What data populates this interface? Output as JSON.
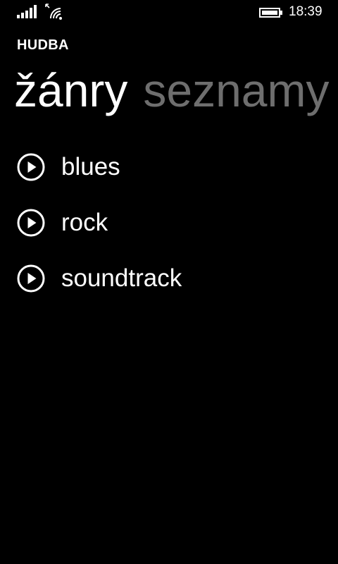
{
  "status_bar": {
    "time": "18:39",
    "icons": [
      "signal-strength-icon",
      "wifi-icon",
      "battery-icon"
    ]
  },
  "app": {
    "title": "HUDBA"
  },
  "pivot": {
    "tabs": [
      {
        "label": "žánry",
        "active": true
      },
      {
        "label": "seznamy",
        "active": false
      }
    ]
  },
  "genres": [
    {
      "label": "blues",
      "icon": "play-icon"
    },
    {
      "label": "rock",
      "icon": "play-icon"
    },
    {
      "label": "soundtrack",
      "icon": "play-icon"
    }
  ],
  "colors": {
    "background": "#000000",
    "foreground": "#ffffff",
    "inactive_tab": "#6e6e6e"
  }
}
